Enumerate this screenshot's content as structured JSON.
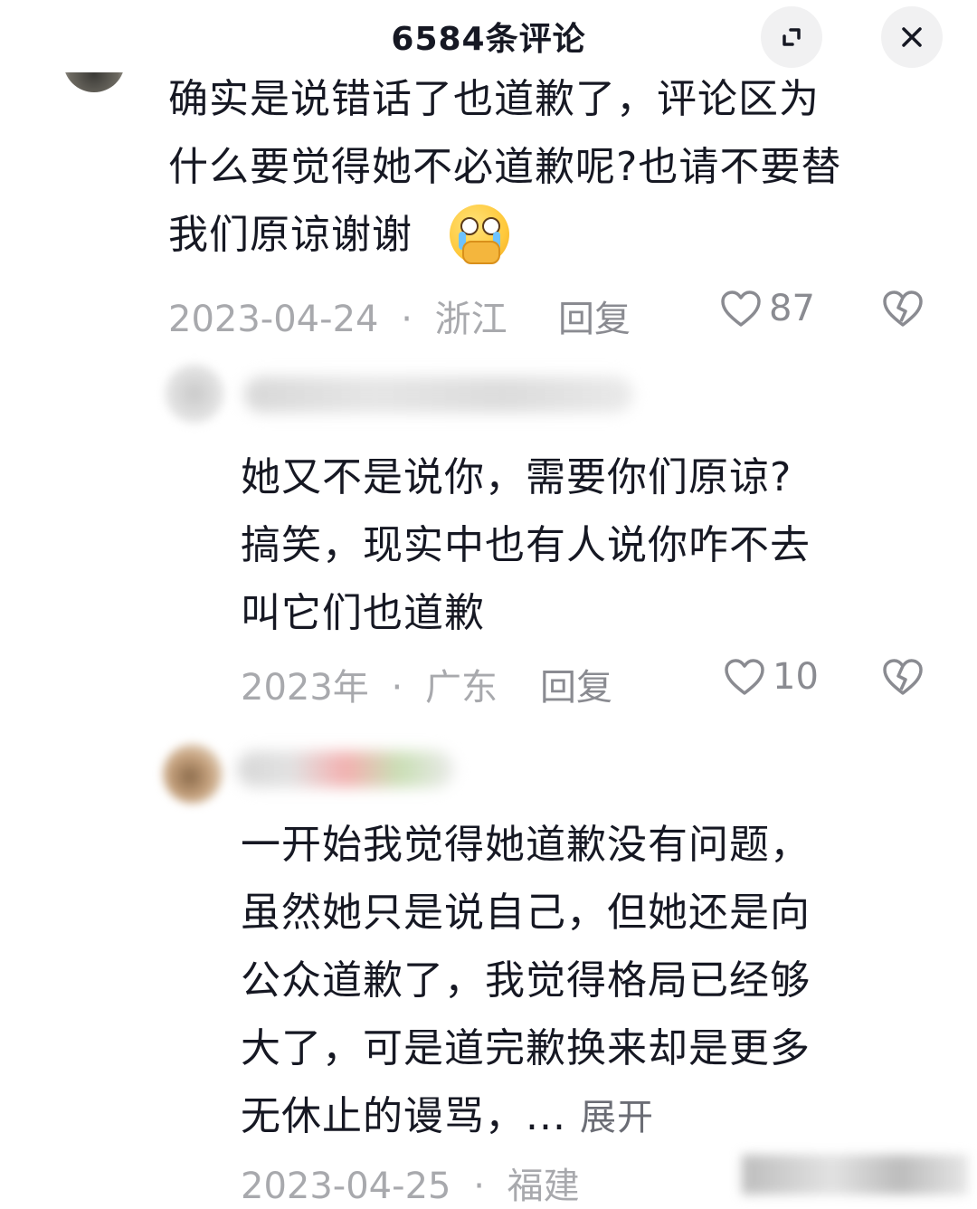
{
  "header": {
    "title": "6584条评论"
  },
  "comments": [
    {
      "lines": [
        "确实是说错话了也道歉了，评论区为",
        "什么要觉得她不必道歉呢?也请不要替",
        "我们原谅谢谢"
      ],
      "emoji": "pleading-face-emoji",
      "date": "2023-04-24",
      "location": "浙江",
      "reply_label": "回复",
      "likes": "87"
    },
    {
      "lines": [
        "她又不是说你，需要你们原谅?",
        "搞笑，现实中也有人说你咋不去",
        "叫它们也道歉"
      ],
      "date": "2023年",
      "location": "广东",
      "reply_label": "回复",
      "likes": "10"
    },
    {
      "lines": [
        "一开始我觉得她道歉没有问题，",
        "虽然她只是说自己，但她还是向",
        "公众道歉了，我觉得格局已经够",
        "大了，可是道完歉换来却是更多"
      ],
      "last_line": "无休止的谩骂，...",
      "expand_label": "展开",
      "date": "2023-04-25",
      "location": "福建"
    }
  ],
  "separator": "·",
  "icons": {
    "expand": "expand-icon",
    "close": "close-icon",
    "like": "heart-icon",
    "dislike": "broken-heart-icon"
  },
  "colors": {
    "text": "#161823",
    "meta": "#a8a9ad",
    "button_bg": "#f1f1f2"
  }
}
